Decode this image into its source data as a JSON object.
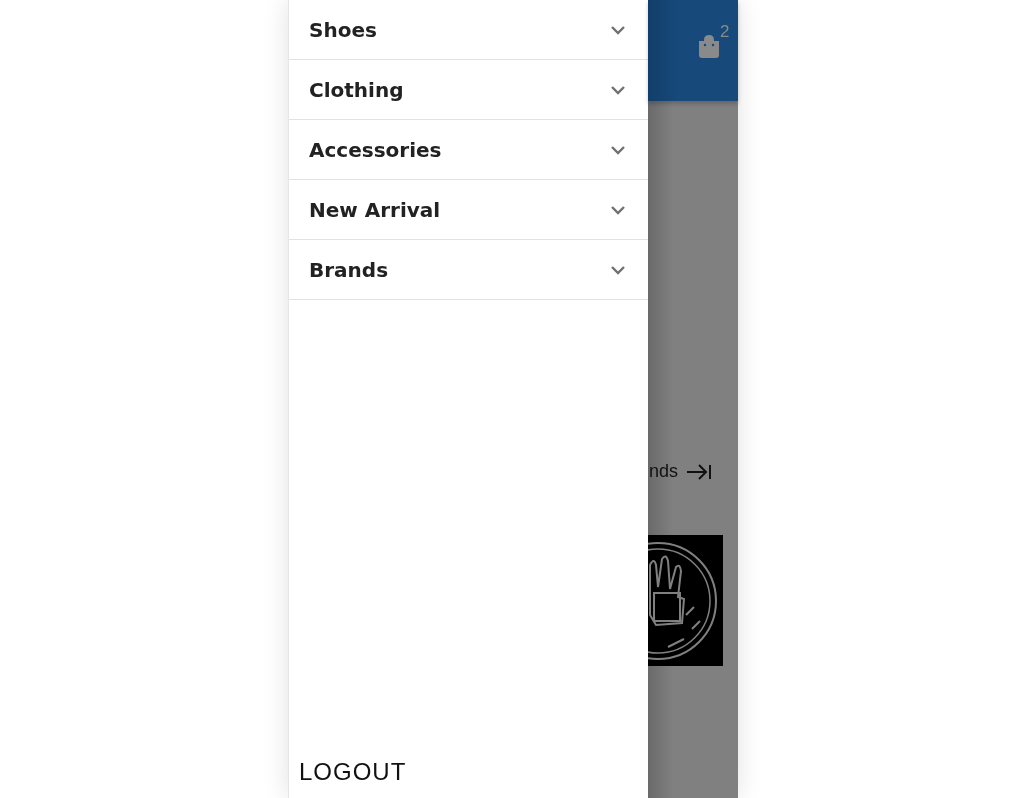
{
  "drawer": {
    "items": [
      {
        "label": "Shoes",
        "expanded": false
      },
      {
        "label": "Clothing",
        "expanded": false
      },
      {
        "label": "Accessories",
        "expanded": false
      },
      {
        "label": "New Arrival",
        "expanded": false
      },
      {
        "label": "Brands",
        "expanded": false
      }
    ],
    "logout": "LOGOUT"
  },
  "background": {
    "cart_count": "2",
    "link_text": "nds"
  }
}
